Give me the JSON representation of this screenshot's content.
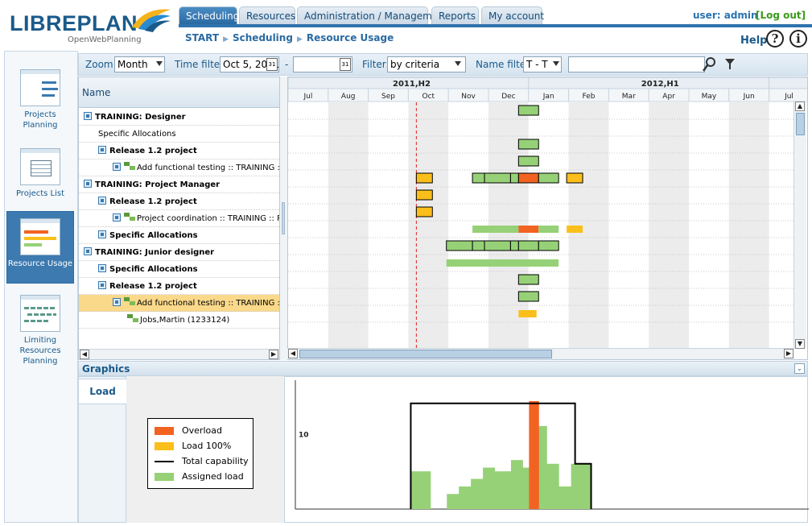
{
  "app": {
    "logo_text": "LIBREPLAN",
    "logo_sub": "OpenWebPlanning",
    "user_text": "user: admin",
    "logout": "[Log out]",
    "help": "Help"
  },
  "tabs": [
    {
      "label": "Scheduling",
      "active": true
    },
    {
      "label": "Resources",
      "active": false
    },
    {
      "label": "Administration / Management",
      "active": false
    },
    {
      "label": "Reports",
      "active": false
    },
    {
      "label": "My account",
      "active": false
    }
  ],
  "breadcrumb": [
    "START",
    "Scheduling",
    "Resource Usage"
  ],
  "sidebar": [
    {
      "label": "Projects Planning",
      "active": false
    },
    {
      "label": "Projects List",
      "active": false
    },
    {
      "label": "Resource Usage",
      "active": true
    },
    {
      "label": "Limiting Resources Planning",
      "active": false
    }
  ],
  "toolbar": {
    "zoom_label": "Zoom:",
    "zoom_value": "Month",
    "time_filter_label": "Time filter:",
    "time_from": "Oct 5, 2011",
    "time_to": "",
    "dash": "-",
    "filter_label": "Filter:",
    "filter_value": "by criteria",
    "name_filter_label": "Name filter:",
    "name_filter_value": "T - T",
    "search_value": ""
  },
  "tree": {
    "header": "Name",
    "rows": [
      {
        "label": "TRAINING: Designer",
        "indent": 0,
        "bold": true,
        "icon": "expand"
      },
      {
        "label": "Specific Allocations",
        "indent": 1,
        "bold": false,
        "icon": "none"
      },
      {
        "label": "Release 1.2 project",
        "indent": 1,
        "bold": true,
        "icon": "expand"
      },
      {
        "label": "Add functional testing :: TRAINING :: J",
        "indent": 2,
        "bold": false,
        "icon": "task"
      },
      {
        "label": "TRAINING: Project Manager",
        "indent": 0,
        "bold": true,
        "icon": "expand"
      },
      {
        "label": "Release 1.2 project",
        "indent": 1,
        "bold": true,
        "icon": "expand"
      },
      {
        "label": "Project coordination :: TRAINING :: Pre",
        "indent": 2,
        "bold": false,
        "icon": "task"
      },
      {
        "label": "Specific Allocations",
        "indent": 1,
        "bold": true,
        "icon": "play"
      },
      {
        "label": "TRAINING: Junior designer",
        "indent": 0,
        "bold": true,
        "icon": "expand"
      },
      {
        "label": "Specific Allocations",
        "indent": 1,
        "bold": true,
        "icon": "play"
      },
      {
        "label": "Release 1.2 project",
        "indent": 1,
        "bold": true,
        "icon": "expand"
      },
      {
        "label": "Add functional testing :: TRAINING :: J",
        "indent": 2,
        "bold": false,
        "icon": "task-selected",
        "selected": true
      },
      {
        "label": "Jobs,Martin (1233124)",
        "indent": 3,
        "bold": false,
        "icon": "task-plain"
      }
    ]
  },
  "gantt": {
    "periods": [
      "2011,H2",
      "2012,H1"
    ],
    "months": [
      "Jul",
      "Aug",
      "Sep",
      "Oct",
      "Nov",
      "Dec",
      "Jan",
      "Feb",
      "Mar",
      "Apr",
      "May",
      "Jun",
      "Jul"
    ],
    "today_month_index": 3.2,
    "colors": {
      "assigned": "#96d177",
      "load100": "#fbbf1b",
      "overload": "#f26322",
      "outline": "#000000"
    },
    "bars": [
      {
        "row": 0,
        "start": 5.75,
        "end": 6.25,
        "color": "assigned",
        "outlined": true
      },
      {
        "row": 2,
        "start": 5.75,
        "end": 6.25,
        "color": "assigned",
        "outlined": true
      },
      {
        "row": 3,
        "start": 5.75,
        "end": 6.25,
        "color": "assigned",
        "outlined": true
      },
      {
        "row": 4,
        "start": 3.2,
        "end": 3.6,
        "color": "load100",
        "outlined": true
      },
      {
        "row": 4,
        "start": 4.6,
        "end": 4.9,
        "color": "assigned",
        "outlined": true
      },
      {
        "row": 4,
        "start": 4.9,
        "end": 5.55,
        "color": "assigned",
        "outlined": true
      },
      {
        "row": 4,
        "start": 5.55,
        "end": 5.75,
        "color": "assigned",
        "outlined": true
      },
      {
        "row": 4,
        "start": 5.75,
        "end": 6.25,
        "color": "overload",
        "outlined": true
      },
      {
        "row": 4,
        "start": 6.25,
        "end": 6.75,
        "color": "assigned",
        "outlined": true
      },
      {
        "row": 4,
        "start": 6.95,
        "end": 7.35,
        "color": "load100",
        "outlined": true
      },
      {
        "row": 5,
        "start": 3.2,
        "end": 3.6,
        "color": "load100",
        "outlined": true
      },
      {
        "row": 6,
        "start": 3.2,
        "end": 3.6,
        "color": "load100",
        "outlined": true
      },
      {
        "row": 7,
        "start": 4.6,
        "end": 5.75,
        "color": "assigned",
        "outlined": false
      },
      {
        "row": 7,
        "start": 5.75,
        "end": 6.25,
        "color": "overload",
        "outlined": false
      },
      {
        "row": 7,
        "start": 6.25,
        "end": 6.75,
        "color": "assigned",
        "outlined": false
      },
      {
        "row": 7,
        "start": 6.95,
        "end": 7.35,
        "color": "load100",
        "outlined": false
      },
      {
        "row": 8,
        "start": 3.95,
        "end": 4.6,
        "color": "assigned",
        "outlined": true
      },
      {
        "row": 8,
        "start": 4.6,
        "end": 4.9,
        "color": "assigned",
        "outlined": true
      },
      {
        "row": 8,
        "start": 4.9,
        "end": 5.55,
        "color": "assigned",
        "outlined": true
      },
      {
        "row": 8,
        "start": 5.55,
        "end": 5.75,
        "color": "assigned",
        "outlined": true
      },
      {
        "row": 8,
        "start": 5.75,
        "end": 6.25,
        "color": "assigned",
        "outlined": true
      },
      {
        "row": 8,
        "start": 6.25,
        "end": 6.75,
        "color": "assigned",
        "outlined": true
      },
      {
        "row": 9,
        "start": 3.95,
        "end": 6.75,
        "color": "assigned",
        "outlined": false
      },
      {
        "row": 10,
        "start": 5.75,
        "end": 6.25,
        "color": "assigned",
        "outlined": true
      },
      {
        "row": 11,
        "start": 5.75,
        "end": 6.25,
        "color": "assigned",
        "outlined": true
      },
      {
        "row": 12,
        "start": 5.75,
        "end": 6.2,
        "color": "load100",
        "outlined": false
      }
    ]
  },
  "graphics": {
    "title": "Graphics",
    "tab": "Load",
    "legend": [
      {
        "label": "Overload",
        "color": "#f26322",
        "type": "fill"
      },
      {
        "label": "Load 100%",
        "color": "#fbbf1b",
        "type": "fill"
      },
      {
        "label": "Total capability",
        "color": "#000000",
        "type": "line"
      },
      {
        "label": "Assigned load",
        "color": "#96d177",
        "type": "fill"
      }
    ],
    "y_tick": "10"
  },
  "chart_data": {
    "type": "area",
    "title": "",
    "xlabel": "",
    "ylabel": "",
    "y_ticks": [
      "10"
    ],
    "ylim": [
      0,
      16
    ],
    "x": [
      "Jul",
      "Aug",
      "Sep",
      "Oct",
      "Nov",
      "Dec",
      "Jan",
      "Feb",
      "Mar",
      "Apr",
      "May",
      "Jun",
      "Jul"
    ],
    "series": [
      {
        "name": "Total capability",
        "type": "line",
        "points": [
          [
            3.1,
            0
          ],
          [
            3.1,
            14
          ],
          [
            7.2,
            14
          ],
          [
            7.2,
            6
          ],
          [
            7.6,
            6
          ],
          [
            7.6,
            0
          ]
        ]
      },
      {
        "name": "Assigned load",
        "type": "area",
        "points": [
          [
            3.1,
            5
          ],
          [
            3.6,
            5
          ],
          [
            3.6,
            0
          ],
          [
            4.0,
            0
          ],
          [
            4.0,
            2
          ],
          [
            4.3,
            2
          ],
          [
            4.3,
            3
          ],
          [
            4.6,
            3
          ],
          [
            4.6,
            4
          ],
          [
            4.9,
            4
          ],
          [
            4.9,
            5.5
          ],
          [
            5.2,
            5.5
          ],
          [
            5.2,
            5
          ],
          [
            5.6,
            5
          ],
          [
            5.6,
            6.5
          ],
          [
            5.9,
            6.5
          ],
          [
            5.9,
            5.5
          ],
          [
            6.2,
            5.5
          ],
          [
            6.2,
            11
          ],
          [
            6.5,
            11
          ],
          [
            6.5,
            6
          ],
          [
            6.8,
            6
          ],
          [
            6.8,
            3
          ],
          [
            7.1,
            3
          ],
          [
            7.1,
            6
          ],
          [
            7.6,
            6
          ],
          [
            7.6,
            0
          ]
        ]
      },
      {
        "name": "Overload",
        "type": "area",
        "points": [
          [
            6.05,
            14
          ],
          [
            6.05,
            14.3
          ],
          [
            6.3,
            14.3
          ],
          [
            6.3,
            14
          ]
        ]
      }
    ]
  }
}
